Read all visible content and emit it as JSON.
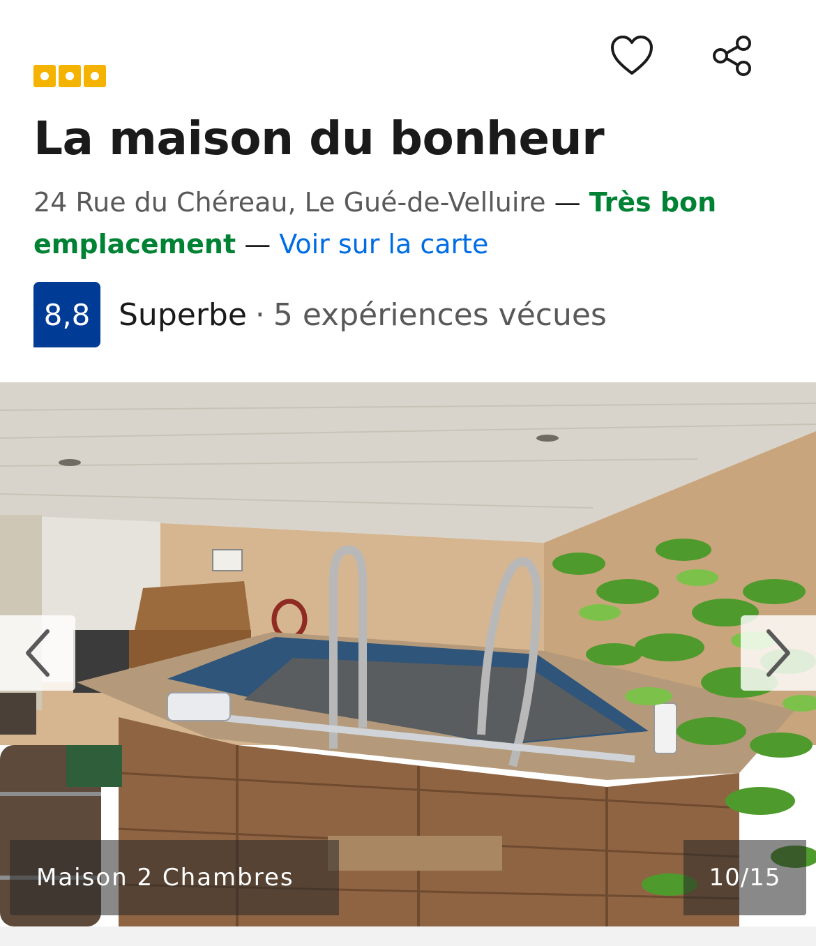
{
  "property": {
    "stars_count": 3,
    "star_color": "#f5b301",
    "title": "La maison du bonheur",
    "address": "24 Rue du Chéreau, Le Gué-de-Velluire",
    "separator": " — ",
    "location_label": "Très bon emplacement",
    "map_link": "Voir sur la carte"
  },
  "actions": {
    "favorite_icon": "heart-outline-icon",
    "share_icon": "share-icon"
  },
  "rating": {
    "score": "8,8",
    "label": "Superbe",
    "dot": "·",
    "count": "5 expériences vécues",
    "badge_color": "#003b95"
  },
  "gallery": {
    "caption": "Maison 2 Chambres",
    "counter": "10/15",
    "current": 10,
    "total": 15,
    "prev_icon": "chevron-left-icon",
    "next_icon": "chevron-right-icon"
  },
  "colors": {
    "location_green": "#008234",
    "link_blue": "#006ce4"
  }
}
